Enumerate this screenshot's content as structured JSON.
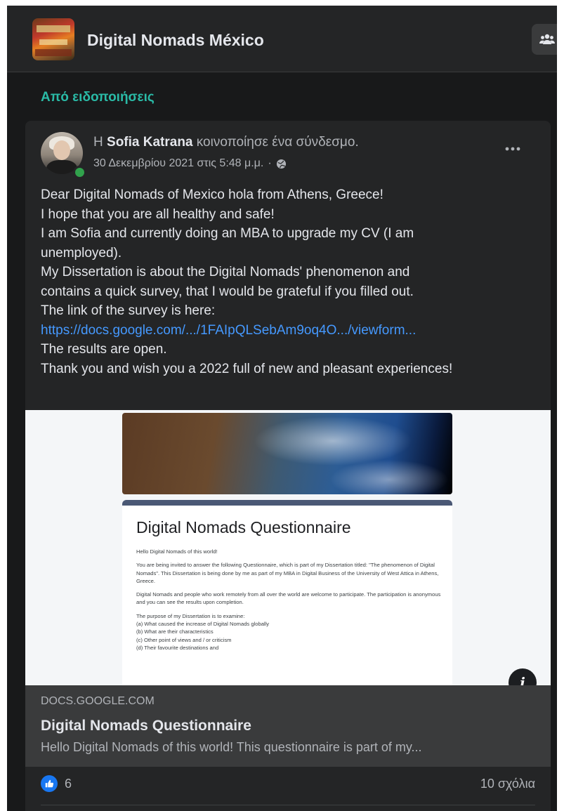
{
  "group": {
    "name": "Digital Nomads México",
    "logo_icon": "group-logo",
    "members_icon": "members-icon"
  },
  "section": {
    "label": "Από ειδοποιήσεις"
  },
  "post": {
    "author_prefix": "Η",
    "author": "Sofia Katrana",
    "action": "κοινοποίησε ένα σύνδεσμο.",
    "timestamp": "30 Δεκεμβρίου 2021 στις 5:48 μ.μ.",
    "separator": "·",
    "privacy_icon": "globe-icon",
    "more_icon": "more-options-icon",
    "text_lines": [
      "Dear Digital Nomads of Mexico hola from Athens, Greece!",
      "I hope that you are all healthy and safe!",
      "I am Sofia and currently doing an MBA to upgrade my CV (I am",
      "unemployed).",
      "My Dissertation is about the Digital Nomads' phenomenon and",
      "contains a quick survey, that I would be grateful if you filled out.",
      "The link of the survey is here:",
      "https://docs.google.com/.../1FAIpQLSebAm9oq4O.../viewform...",
      "The results are open.",
      "Thank you and wish you a 2022 full of new and pleasant experiences!"
    ]
  },
  "preview": {
    "form_title": "Digital Nomads Questionnaire",
    "form_paragraphs": [
      "Hello Digital Nomads of this world!",
      "You are being invited to answer the following Questionnaire, which is part of my Dissertation titled: \"The phenomenon of Digital Nomads\". This Dissertation is being done by me as part of my MBA in Digital Business of the University of West Attica in Athens, Greece.",
      "Digital Nomads and people who work remotely from all over the world are welcome to participate. The participation is anonymous and you can see the results upon completion.",
      "The purpose of my Dissertation is to examine:\n(a) What caused the increase of Digital Nomads globally\n(b) What are their characteristics\n(c) Other point of views and / or criticism\n(d) Their favourite destinations and"
    ],
    "info_label": "i"
  },
  "link": {
    "domain": "DOCS.GOOGLE.COM",
    "title": "Digital Nomads Questionnaire",
    "description": "Hello Digital Nomads of this world! This questionnaire is part of my..."
  },
  "reactions": {
    "like_icon": "like-icon",
    "count": "6",
    "comments": "10 σχόλια"
  },
  "colors": {
    "background": "#18191a",
    "card": "#242526",
    "accent_green": "#2abba7",
    "link_blue": "#4599ff",
    "like_blue": "#1877f2"
  }
}
